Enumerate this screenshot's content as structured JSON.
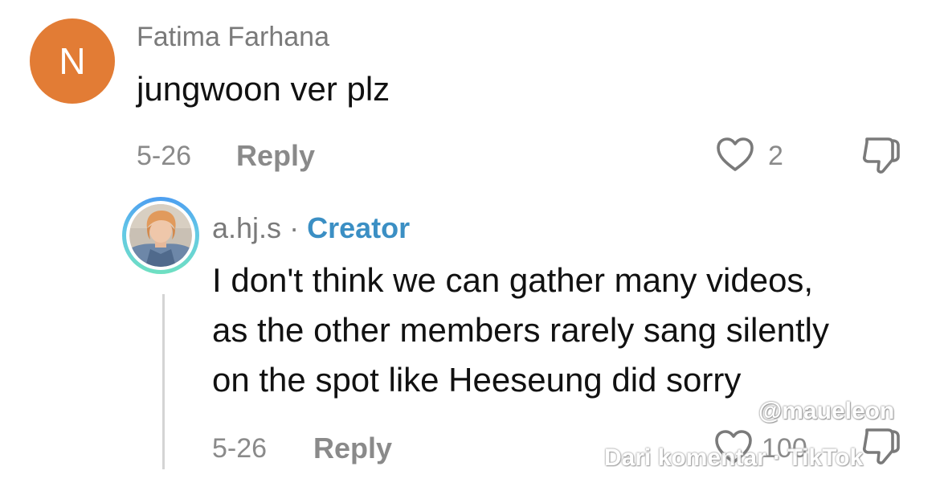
{
  "comment": {
    "avatar_letter": "N",
    "avatar_color": "#e27c35",
    "username": "Fatima Farhana",
    "text": "jungwoon ver plz",
    "date": "5-26",
    "reply_label": "Reply",
    "like_icon": "heart-outline-icon",
    "like_count": "2",
    "dislike_icon": "thumbs-down-icon"
  },
  "reply": {
    "avatar_icon": "profile-photo",
    "username": "a.hj.s",
    "separator": "·",
    "badge": "Creator",
    "badge_color": "#3b8fc4",
    "text_lines": [
      "I don't think we can gather many videos,",
      "as the other members rarely sang silently",
      "on the spot like Heeseung did sorry"
    ],
    "date": "5-26",
    "reply_label": "Reply",
    "like_icon": "heart-outline-icon",
    "like_count": "100",
    "dislike_icon": "thumbs-down-icon"
  },
  "watermark": {
    "handle": "@maueleon",
    "line": "Dari komentar · TikTok"
  }
}
